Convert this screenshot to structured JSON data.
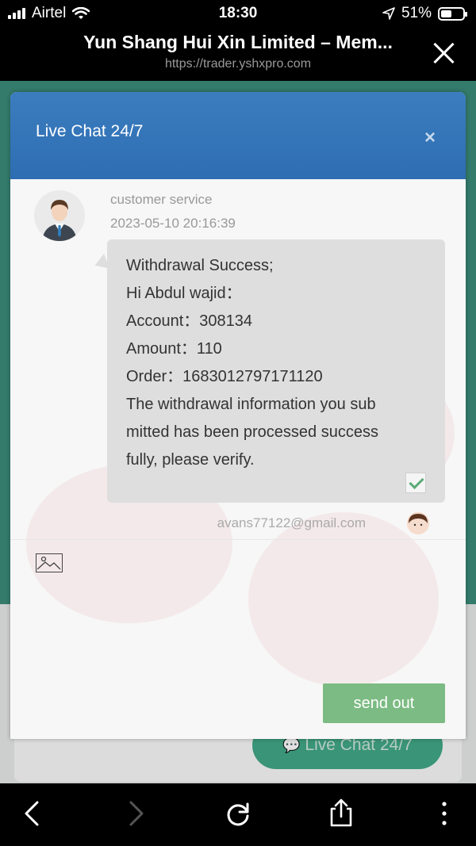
{
  "status_bar": {
    "carrier": "Airtel",
    "time": "18:30",
    "battery": "51%",
    "battery_level": 0.51,
    "icons": [
      "signal-icon",
      "wifi-icon",
      "location-arrow-icon",
      "battery-icon"
    ]
  },
  "browser": {
    "title": "Yun Shang Hui Xin Limited – Mem...",
    "url": "https://trader.yshxpro.com",
    "close_icon": "close-icon"
  },
  "background_page": {
    "live_chat_button": "Live Chat 24/7"
  },
  "chat_dialog": {
    "title": "Live Chat 24/7",
    "close_label": "×",
    "message": {
      "sender": "customer service",
      "timestamp": "2023-05-10 20:16:39",
      "lines": [
        "Withdrawal Success;",
        "Hi Abdul wajid：",
        "Account：308134",
        "Amount：110",
        "Order：1683012797171120",
        "The withdrawal information you sub",
        "mitted has been processed success",
        "fully, please verify."
      ],
      "read": true
    },
    "user_email": "avans77122@gmail.com",
    "image_upload_icon": "image-icon",
    "send_button": "send out"
  },
  "toolbar": {
    "icons": [
      "back-icon",
      "forward-icon",
      "reload-icon",
      "share-icon",
      "more-icon"
    ]
  },
  "colors": {
    "dialog_header": "#3476b8",
    "send_button": "#7cbb83",
    "page_background": "#3c8c7a",
    "live_chat_button": "#43a988"
  }
}
